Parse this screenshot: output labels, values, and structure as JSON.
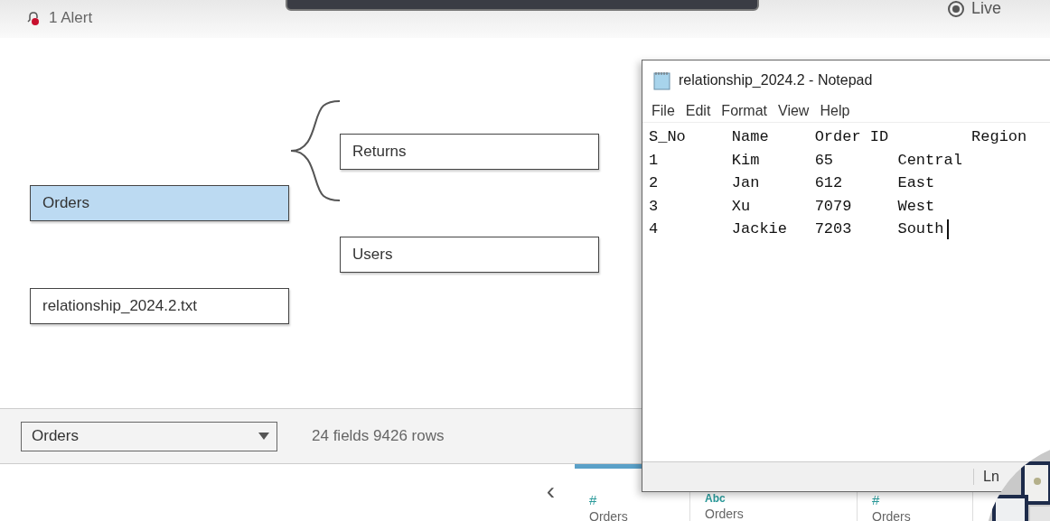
{
  "top_bar": {
    "alert": "1 Alert",
    "live": {
      "label": "Live",
      "selected": true
    }
  },
  "canvas": {
    "tables": [
      {
        "name": "Orders",
        "selected": true
      },
      {
        "name": "Returns",
        "selected": false
      },
      {
        "name": "Users",
        "selected": false
      },
      {
        "name": "relationship_2024.2.txt",
        "selected": false
      }
    ]
  },
  "table_bar": {
    "dropdown": "Orders",
    "summary": "24 fields 9426 rows"
  },
  "grid": {
    "prev": "‹",
    "columns": [
      {
        "type": "#",
        "source": "Orders"
      },
      {
        "type": "Abc",
        "source": "Orders"
      },
      {
        "type": "#",
        "source": "Orders"
      }
    ]
  },
  "notepad": {
    "title": "relationship_2024.2 - Notepad",
    "menu": [
      {
        "label": "File"
      },
      {
        "label": "Edit"
      },
      {
        "label": "Format"
      },
      {
        "label": "View"
      },
      {
        "label": "Help"
      }
    ],
    "lines": [
      "S_No     Name     Order ID         Region",
      "1        Kim      65       Central",
      "2        Jan      612      East",
      "3        Xu       7079     West",
      "4        Jackie   7203     South"
    ],
    "status": "Ln"
  }
}
